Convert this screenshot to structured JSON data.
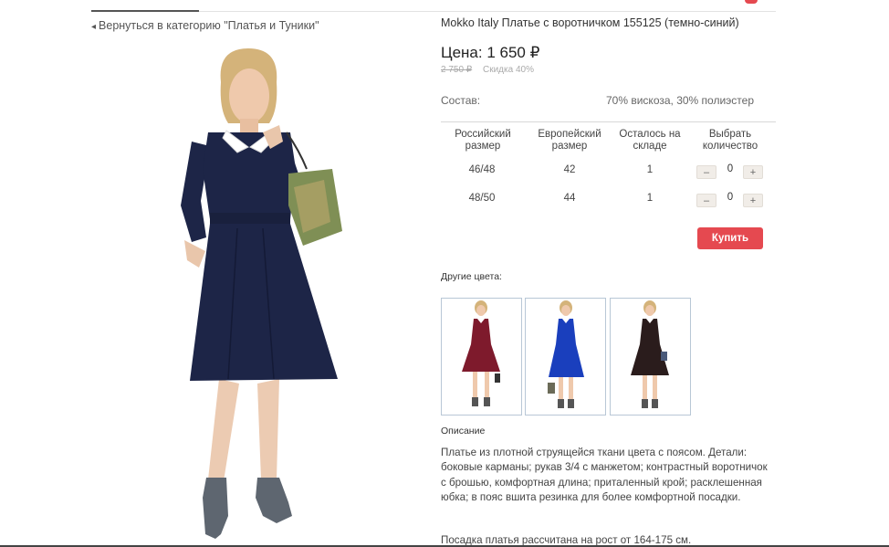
{
  "nav": {
    "back_link": "Вернуться в категорию \"Платья и Туники\""
  },
  "product": {
    "title": "Mokko Italy Платье с воротничком 155125 (темно-синий)",
    "price_label": "Цена:",
    "price": "1 650 ₽",
    "old_price": "2 750 ₽",
    "discount": "Скидка 40%",
    "composition_label": "Состав:",
    "composition_value": "70% вискоза, 30% полиэстер"
  },
  "size_table": {
    "headers": [
      "Российский размер",
      "Европейский размер",
      "Осталось на складе",
      "Выбрать количество"
    ],
    "rows": [
      {
        "ru": "46/48",
        "eu": "42",
        "stock": "1",
        "qty": "0"
      },
      {
        "ru": "48/50",
        "eu": "44",
        "stock": "1",
        "qty": "0"
      }
    ],
    "minus": "–",
    "plus": "+"
  },
  "buy_button": "Купить",
  "other_colors": {
    "label": "Другие цвета:",
    "items": [
      "burgundy",
      "royal-blue",
      "black"
    ]
  },
  "description": {
    "title": "Описание",
    "text": "Платье из плотной струящейся ткани цвета с поясом. Детали: боковые карманы; рукав 3/4 с манжетом; контрастный воротничок с брошью, комфортная длина; приталенный крой; расклешенная юбка; в пояс вшита резинка для более комфортной посадки.",
    "fit": "Посадка платья рассчитана на рост от 164-175 см."
  },
  "colors": {
    "accent": "#e54950",
    "dress_main": "#1d2547",
    "dress_swatch_1": "#7e1a2c",
    "dress_swatch_2": "#1a3fbd",
    "dress_swatch_3": "#2a1c1c"
  }
}
